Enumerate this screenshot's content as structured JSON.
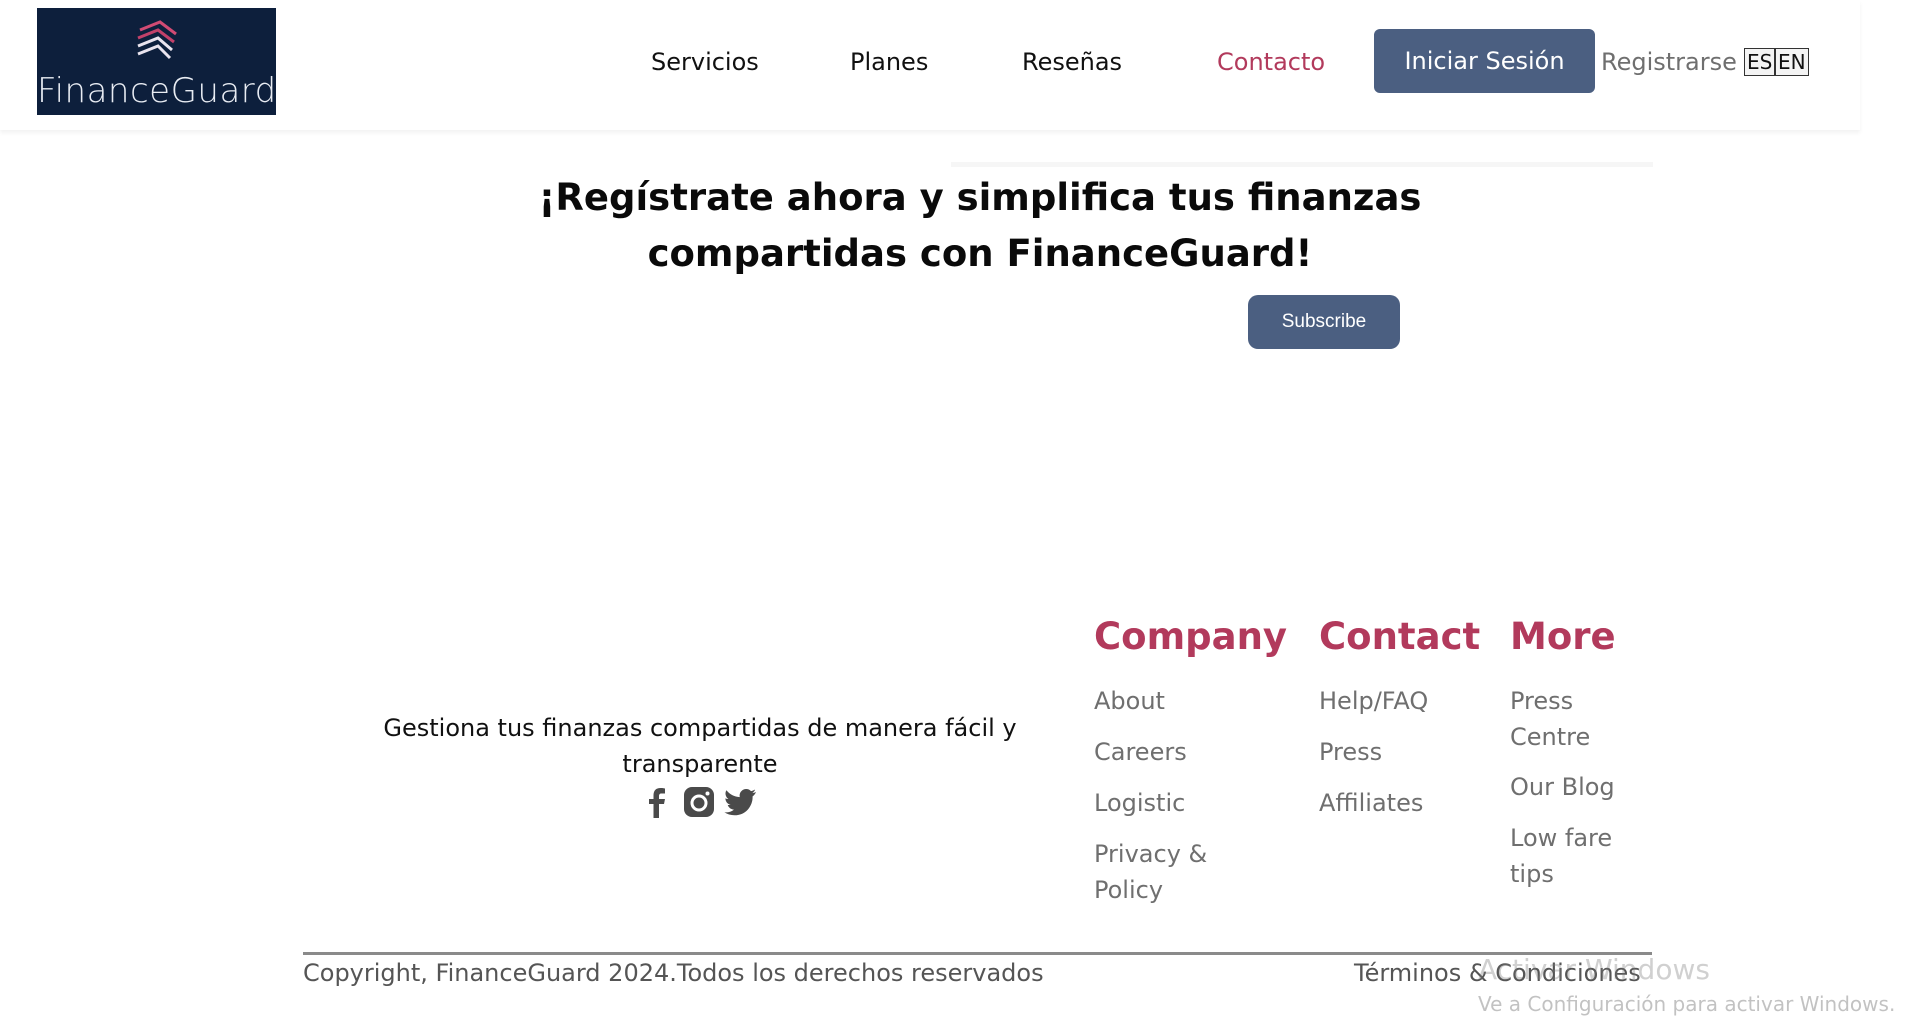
{
  "brand": {
    "name": "FinanceGuard",
    "logo_icon": "layers-icon",
    "logo_bg": "#0d1f3c",
    "logo_accent": "#c2416a"
  },
  "nav": {
    "items": [
      {
        "label": "Servicios",
        "active": false
      },
      {
        "label": "Planes",
        "active": false
      },
      {
        "label": "Reseñas",
        "active": false
      },
      {
        "label": "Contacto",
        "active": true
      }
    ],
    "login_label": "Iniciar Sesión",
    "register_label": "Registrarse",
    "lang_es": "ES",
    "lang_en": "EN"
  },
  "hero": {
    "title_line1": "¡Regístrate ahora y simplifica tus finanzas",
    "title_line2": "compartidas con FinanceGuard!",
    "subscribe_label": "Subscribe"
  },
  "footer": {
    "tagline": "Gestiona tus finanzas compartidas de manera fácil y transparente",
    "social_icons": [
      "facebook-icon",
      "instagram-icon",
      "twitter-icon"
    ],
    "columns": [
      {
        "heading": "Company",
        "links": [
          "About",
          "Careers",
          "Logistic",
          "Privacy & Policy"
        ]
      },
      {
        "heading": "Contact",
        "links": [
          "Help/FAQ",
          "Press",
          "Affiliates"
        ]
      },
      {
        "heading": "More",
        "links": [
          "Press Centre",
          "Our Blog",
          "Low fare tips"
        ]
      }
    ],
    "copyright": "Copyright, FinanceGuard 2024.Todos los derechos reservados",
    "terms": "Términos & Condiciones"
  },
  "os_watermark": {
    "title": "Activar Windows",
    "subtitle": "Ve a Configuración para activar Windows."
  },
  "colors": {
    "accent": "#b23a5c",
    "button": "#4b5f81",
    "muted_text": "#6f6f6f"
  }
}
